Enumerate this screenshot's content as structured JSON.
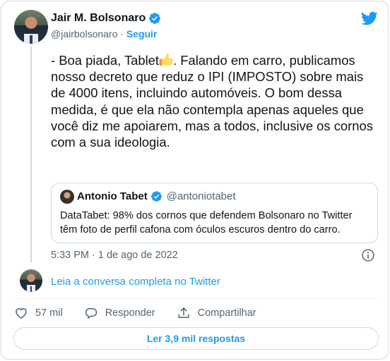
{
  "author": {
    "name": "Jair M. Bolsonaro",
    "handle": "@jairbolsonaro",
    "separator": "·",
    "follow_label": "Seguir"
  },
  "tweet": {
    "text_before_emoji": "- Boa piada, Tablet",
    "emoji_icon": "thumbs-up-icon",
    "text_after_emoji": ". Falando em carro, publicamos nosso decreto que reduz o IPI (IMPOSTO) sobre mais de 4000 itens, incluindo automóveis. O bom dessa medida, é que ela não contempla apenas aqueles que você diz me apoiarem, mas a todos, inclusive os cornos com a sua ideologia.",
    "timestamp": "5:33 PM · 1 de ago de 2022"
  },
  "quote": {
    "name": "Antonio Tabet",
    "handle": "@antoniotabet",
    "text": "DataTabet: 98% dos cornos que defendem Bolsonaro no Twitter têm foto de perfil cafona com óculos escuros dentro do carro."
  },
  "read_conversation": "Leia a conversa completa no Twitter",
  "actions": {
    "likes": "57 mil",
    "reply": "Responder",
    "share": "Compartilhar"
  },
  "read_replies": "Ler 3,9 mil respostas",
  "colors": {
    "accent": "#1d9bf0",
    "text": "#0f1419",
    "secondary": "#536471",
    "border": "#cfd9de"
  }
}
